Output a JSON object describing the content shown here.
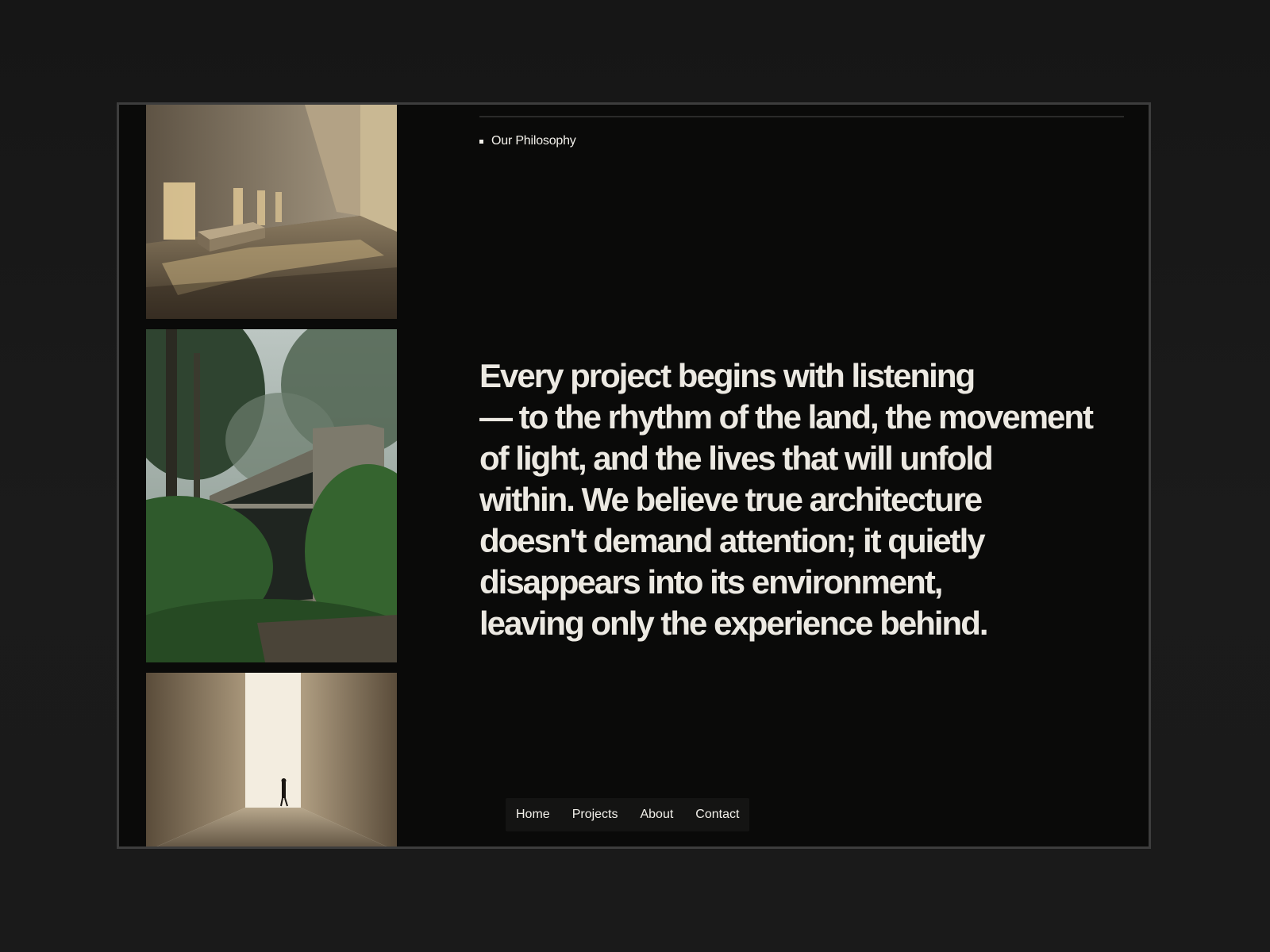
{
  "section": {
    "eyebrow": "Our Philosophy"
  },
  "statement": {
    "lines": [
      "Every project begins with listening",
      "— to the rhythm of the land, the movement",
      "of light, and the lives that will unfold",
      "within. We believe true architecture",
      "doesn't demand attention; it quietly",
      "disappears into its environment,",
      "leaving only the experience behind."
    ]
  },
  "nav": {
    "items": [
      "Home",
      "Projects",
      "About",
      "Contact"
    ]
  },
  "colors": {
    "page_background": "#1a1a1a",
    "frame_background": "#0a0a09",
    "text": "#ece9e2",
    "nav_background": "#141413"
  }
}
